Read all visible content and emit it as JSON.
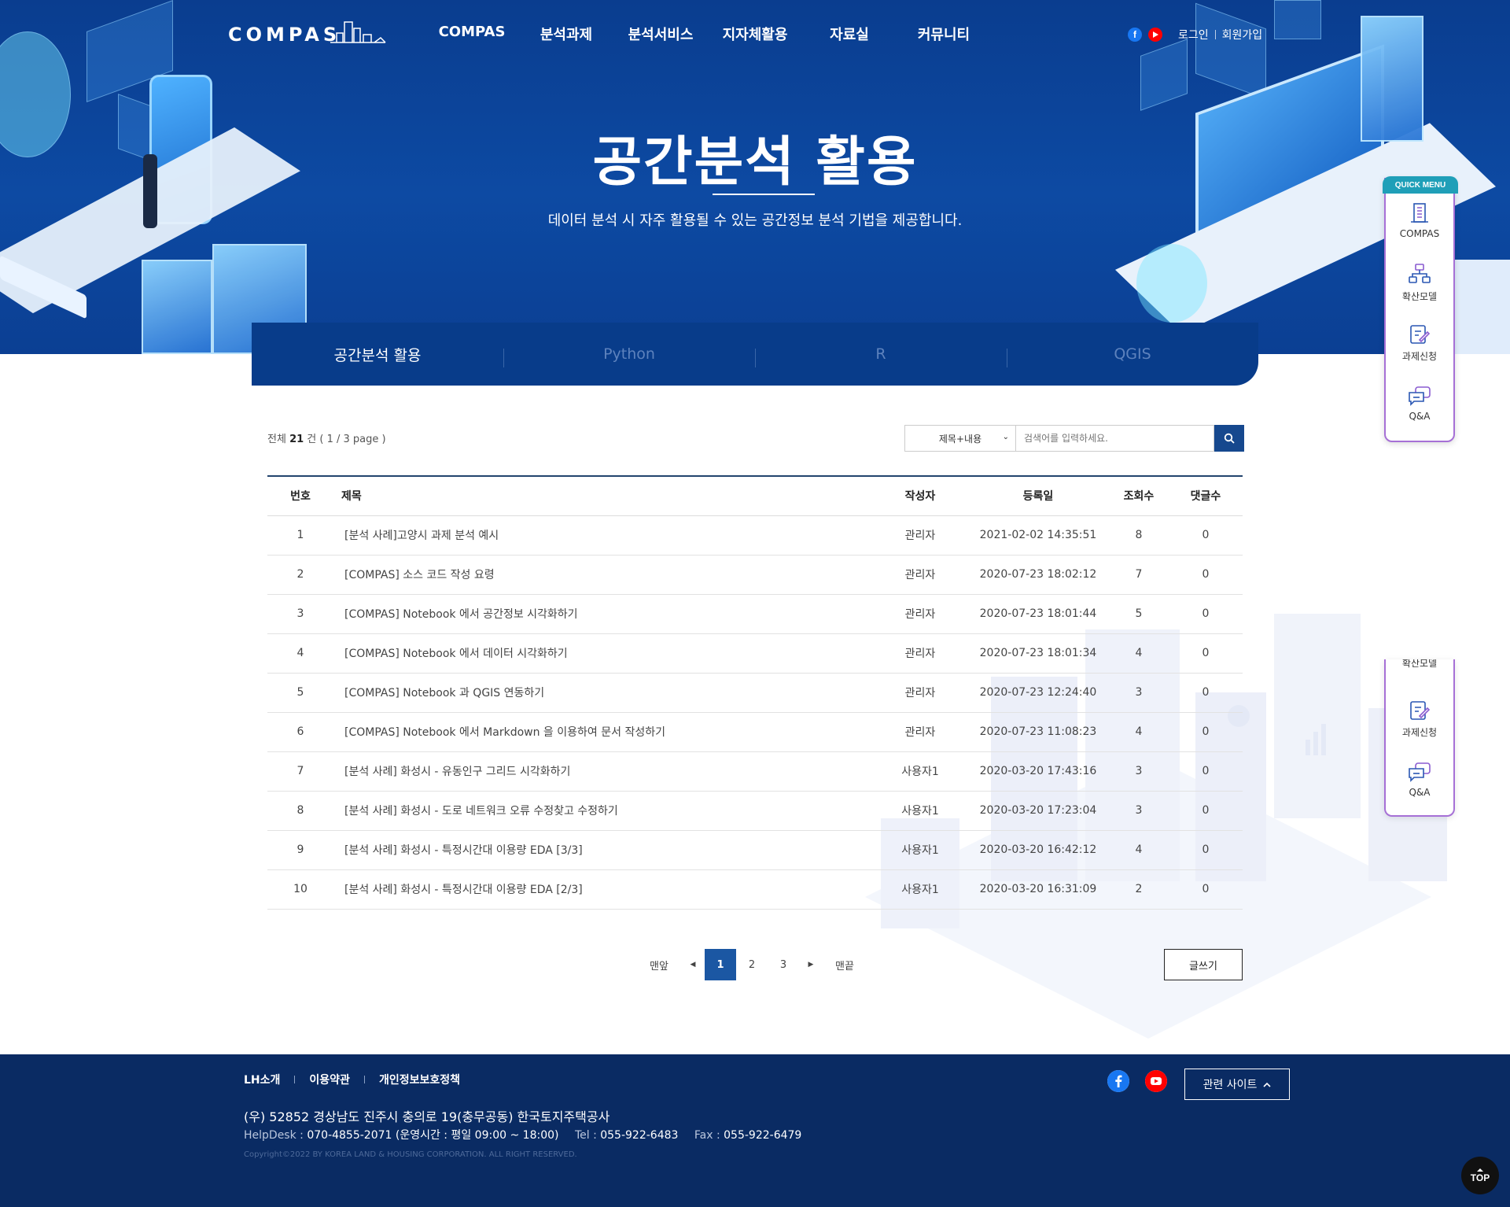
{
  "header": {
    "logo": "COMPAS",
    "nav": [
      "COMPAS",
      "분석과제",
      "분석서비스",
      "지자체활용",
      "자료실",
      "커뮤니티"
    ],
    "login": "로그인",
    "signup": "회원가입",
    "facebook_icon": "facebook-icon",
    "youtube_icon": "youtube-icon"
  },
  "hero": {
    "title": "공간분석 활용",
    "subtitle": "데이터 분석 시 자주 활용될 수 있는 공간정보 분석 기법을 제공합니다."
  },
  "tabs": [
    {
      "label": "공간분석 활용",
      "active": true
    },
    {
      "label": "Python",
      "active": false
    },
    {
      "label": "R",
      "active": false
    },
    {
      "label": "QGIS",
      "active": false
    }
  ],
  "list_info": {
    "prefix": "전체",
    "count": "21",
    "suffix": "건 ( 1 / 3 page )"
  },
  "search": {
    "select_value": "제목+내용",
    "placeholder": "검색어를 입력하세요.",
    "button_icon": "search-icon"
  },
  "table": {
    "headers": [
      "번호",
      "제목",
      "작성자",
      "등록일",
      "조회수",
      "댓글수"
    ],
    "rows": [
      [
        "1",
        "[분석 사례]고양시 과제 분석 예시",
        "관리자",
        "2021-02-02 14:35:51",
        "8",
        "0"
      ],
      [
        "2",
        "[COMPAS] 소스 코드 작성 요령",
        "관리자",
        "2020-07-23 18:02:12",
        "7",
        "0"
      ],
      [
        "3",
        "[COMPAS] Notebook 에서 공간정보 시각화하기",
        "관리자",
        "2020-07-23 18:01:44",
        "5",
        "0"
      ],
      [
        "4",
        "[COMPAS] Notebook 에서 데이터 시각화하기",
        "관리자",
        "2020-07-23 18:01:34",
        "4",
        "0"
      ],
      [
        "5",
        "[COMPAS] Notebook 과 QGIS 연동하기",
        "관리자",
        "2020-07-23 12:24:40",
        "3",
        "0"
      ],
      [
        "6",
        "[COMPAS] Notebook 에서 Markdown 을 이용하여 문서 작성하기",
        "관리자",
        "2020-07-23 11:08:23",
        "4",
        "0"
      ],
      [
        "7",
        "[분석 사례] 화성시 - 유동인구 그리드 시각화하기",
        "사용자1",
        "2020-03-20 17:43:16",
        "3",
        "0"
      ],
      [
        "8",
        "[분석 사례] 화성시 - 도로 네트워크 오류 수정찾고 수정하기",
        "사용자1",
        "2020-03-20 17:23:04",
        "3",
        "0"
      ],
      [
        "9",
        "[분석 사례] 화성시 - 특정시간대 이용량 EDA [3/3]",
        "사용자1",
        "2020-03-20 16:42:12",
        "4",
        "0"
      ],
      [
        "10",
        "[분석 사례] 화성시 - 특정시간대 이용량 EDA [2/3]",
        "사용자1",
        "2020-03-20 16:31:09",
        "2",
        "0"
      ]
    ]
  },
  "pagination": {
    "first": "맨앞",
    "prev": "◀",
    "pages": [
      "1",
      "2",
      "3"
    ],
    "current": "1",
    "next": "▶",
    "last": "맨끝"
  },
  "write_button": "글쓰기",
  "quick_menu": {
    "tag": "QUICK MENU",
    "items": [
      {
        "label": "COMPAS",
        "icon": "building-icon"
      },
      {
        "label": "확산모델",
        "icon": "network-icon"
      },
      {
        "label": "과제신청",
        "icon": "edit-document-icon"
      },
      {
        "label": "Q&A",
        "icon": "chat-bubbles-icon"
      }
    ],
    "ghost_items": [
      {
        "label": "확산모델"
      },
      {
        "label": "과제신청"
      },
      {
        "label": "Q&A"
      }
    ]
  },
  "footer": {
    "links": [
      "LH소개",
      "이용약관",
      "개인정보보호정책"
    ],
    "address": "(우) 52852 경상남도 진주시 충의로 19(충무공동) 한국토지주택공사",
    "helpdesk_label": "HelpDesk :",
    "helpdesk_value": "070-4855-2071 (운영시간 : 평일 09:00 ~ 18:00)",
    "tel_label": "Tel :",
    "tel_value": "055-922-6483",
    "fax_label": "Fax :",
    "fax_value": "055-922-6479",
    "copyright": "Copyright©2022 BY KOREA LAND & HOUSING CORPORATION. ALL RIGHT RESERVED.",
    "related": "관련 사이트"
  },
  "top_button": "TOP",
  "colors": {
    "hero_bg": "#0d4aa3",
    "tab_bar": "#083c8a",
    "accent": "#1b57a3",
    "footer_bg": "#0a2b63",
    "quick_border": "#a670d6"
  }
}
